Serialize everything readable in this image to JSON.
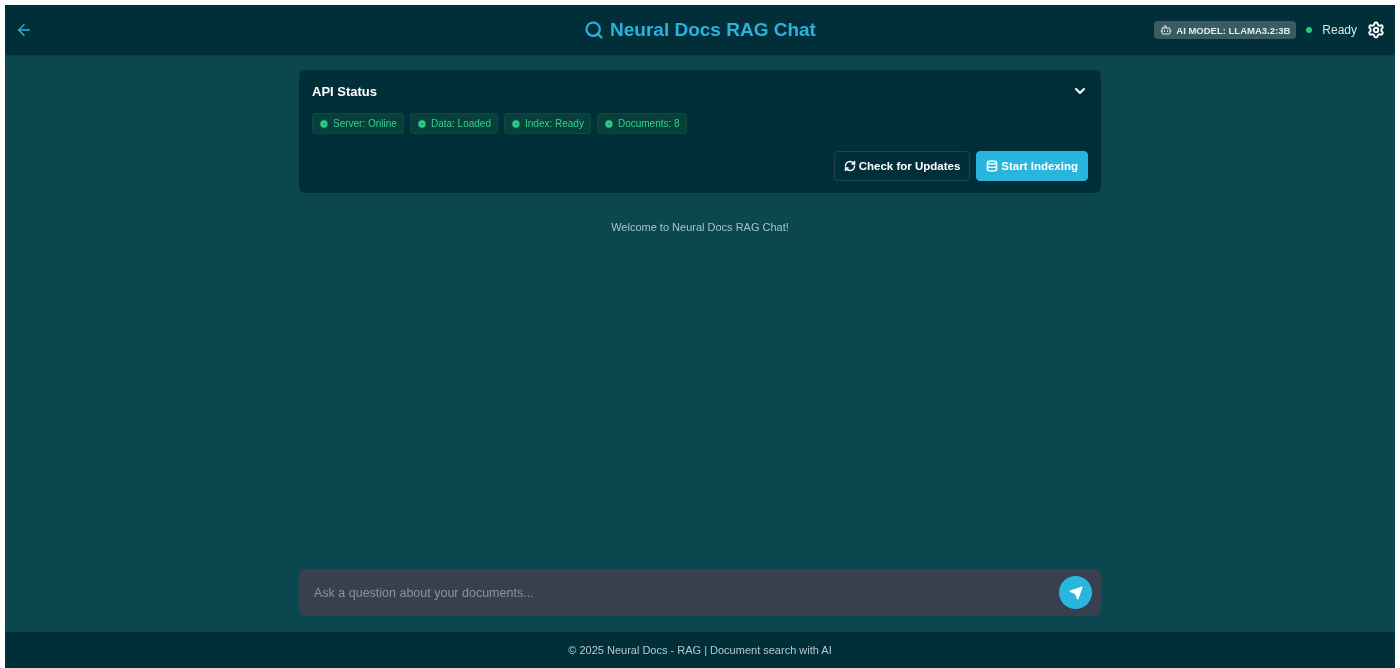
{
  "header": {
    "title": "Neural Docs RAG Chat",
    "model_badge": "AI MODEL: LLAMA3.2:3B",
    "status": {
      "label": "Ready",
      "color": "#2ecc71"
    }
  },
  "api_status": {
    "title": "API Status",
    "expanded": true,
    "badges": [
      {
        "label": "Server: Online",
        "ok": true
      },
      {
        "label": "Data: Loaded",
        "ok": true
      },
      {
        "label": "Index: Ready",
        "ok": true
      },
      {
        "label": "Documents: 8",
        "ok": true
      }
    ],
    "buttons": [
      {
        "label": "Check for Updates",
        "kind": "secondary"
      },
      {
        "label": "Start Indexing",
        "kind": "primary"
      }
    ]
  },
  "chat": {
    "welcome": "Welcome to Neural Docs RAG Chat!"
  },
  "input": {
    "placeholder": "Ask a question about your documents..."
  },
  "footer": "© 2025 Neural Docs - RAG | Document search with AI"
}
